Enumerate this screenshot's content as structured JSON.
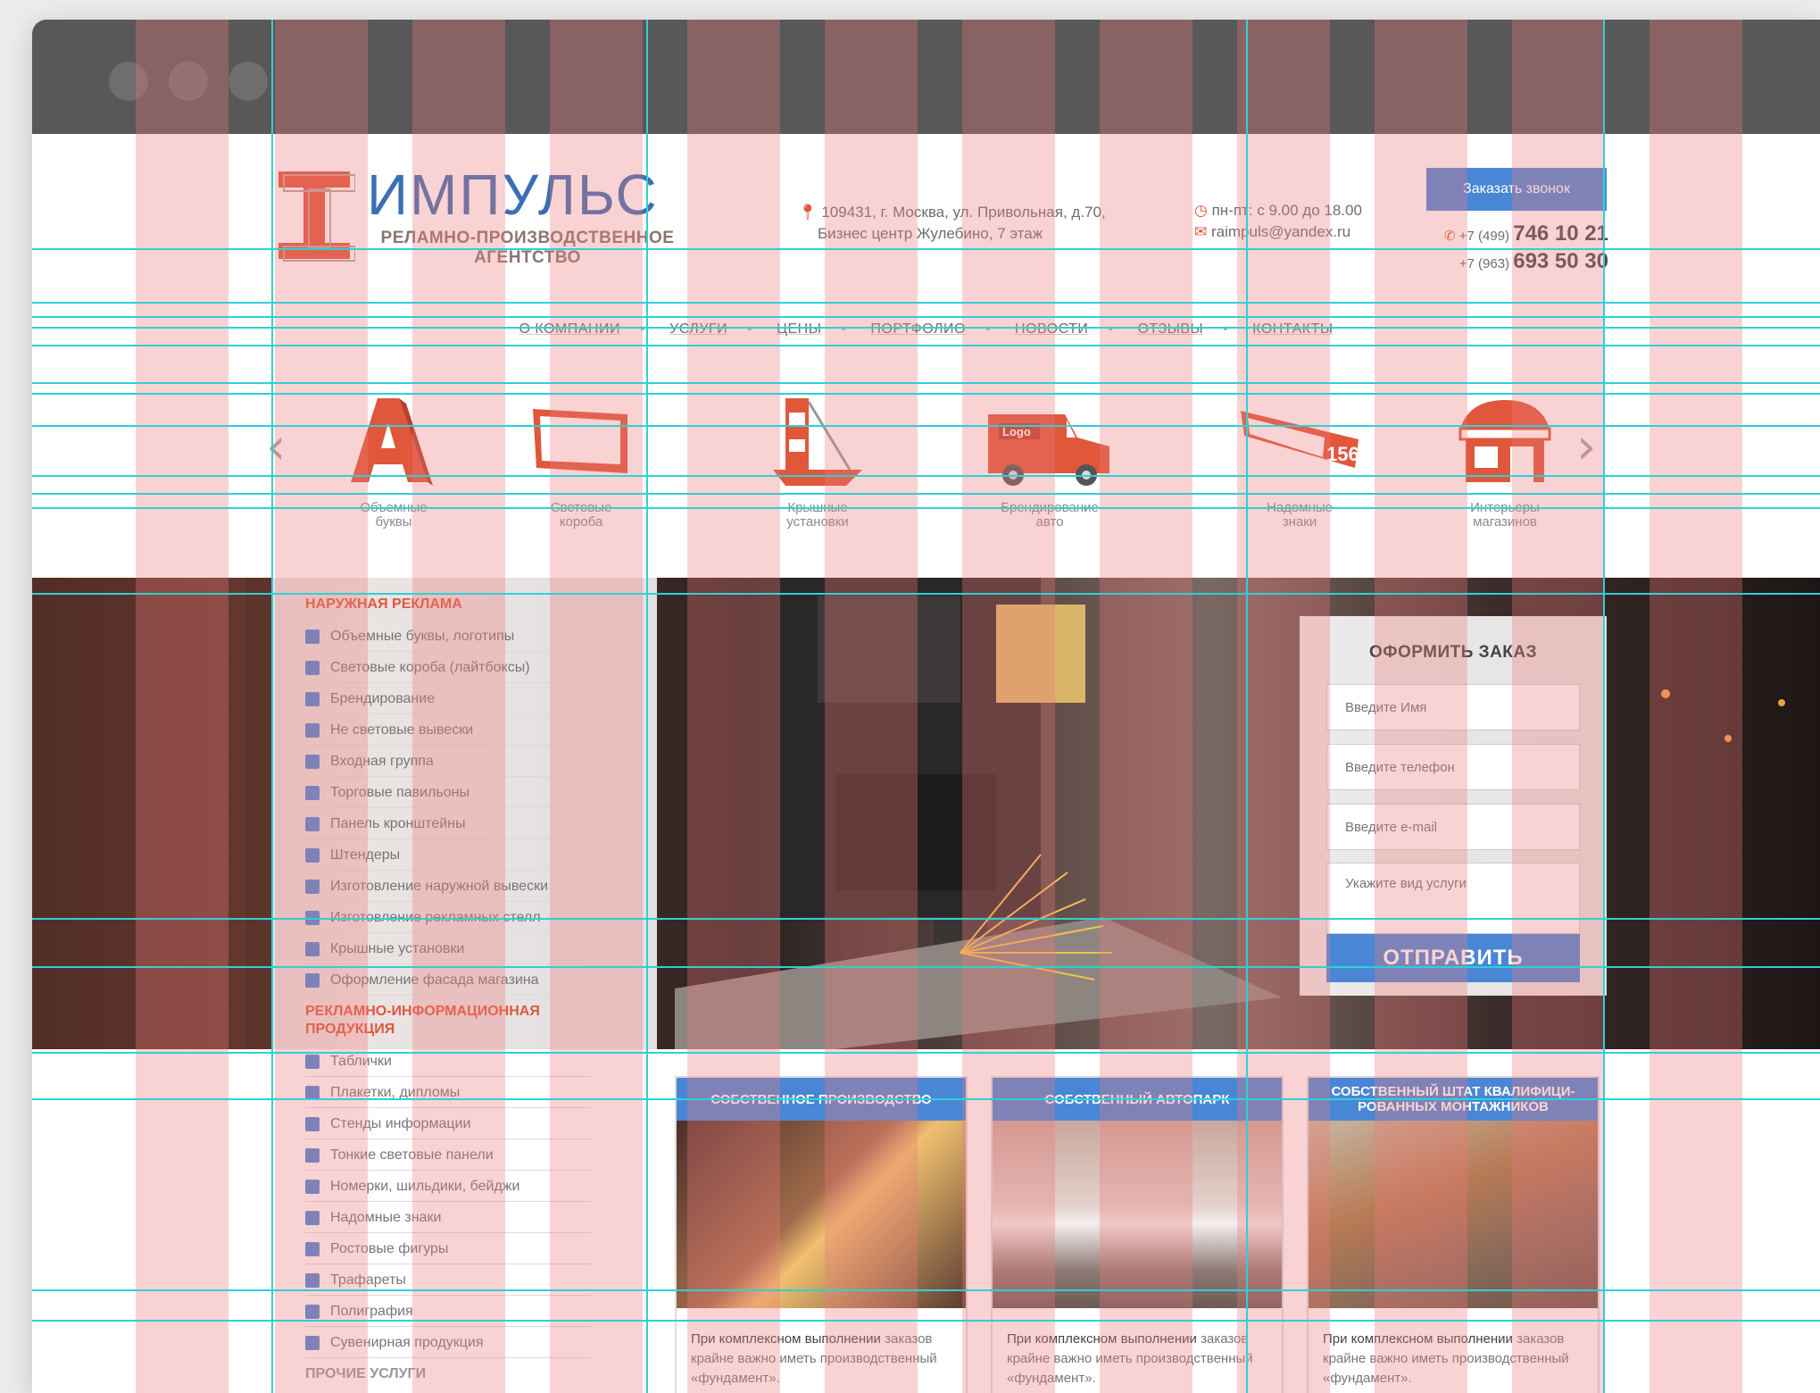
{
  "header": {
    "logo_title": "ИМПУЛЬС",
    "logo_sub1": "РЕЛАМНО-ПРОИЗВОДСТВЕННОЕ",
    "logo_sub2": "АГЕНТСТВО",
    "address_line1": "109431, г. Москва, ул. Привольная, д.70,",
    "address_line2": "Бизнес центр Жулебино, 7 этаж",
    "hours": "пн-пт: с 9.00 до 18.00",
    "email": "raimpuls@yandex.ru",
    "callback_button": "Заказать звонок",
    "phone1_prefix": "+7 (499)",
    "phone1_number": "746 10 21",
    "phone2_prefix": "+7 (963)",
    "phone2_number": "693 50 30"
  },
  "nav": {
    "items": [
      "О КОМПАНИИ",
      "УСЛУГИ",
      "ЦЕНЫ",
      "ПОРТФОЛИО",
      "НОВОСТИ",
      "ОТЗЫВЫ",
      "КОНТАКТЫ"
    ]
  },
  "carousel": {
    "items": [
      {
        "line1": "Объемные",
        "line2": "буквы"
      },
      {
        "line1": "Световые",
        "line2": "короба"
      },
      {
        "line1": "Крышные",
        "line2": "установки"
      },
      {
        "line1": "Брендирование",
        "line2": "авто"
      },
      {
        "line1": "Надомные",
        "line2": "знаки"
      },
      {
        "line1": "Интерьеры",
        "line2": "магазинов"
      }
    ],
    "truck_logo": "Logo",
    "sign_number": "156"
  },
  "sidebar": {
    "head1": "НАРУЖНАЯ РЕКЛАМА",
    "group1": [
      "Объемные буквы, логотипы",
      "Световые короба (лайтбоксы)",
      "Брендирование",
      "Не световые вывески",
      "Входная группа",
      "Торговые павильоны",
      "Панель кронштейны",
      "Штендеры",
      "Изготовление наружной вывески",
      "Изготовление рекламных стелл",
      "Крышные установки",
      "Оформление фасада магазина"
    ],
    "head2": "РЕКЛАМНО-ИНФОРМАЦИОННАЯ ПРОДУКЦИЯ",
    "group2": [
      "Таблички",
      "Плакетки, дипломы",
      "Стенды информации",
      "Тонкие световые панели",
      "Номерки, шильдики, бейджи",
      "Надомные знаки",
      "Ростовые фигуры",
      "Трафареты",
      "Полиграфия",
      "Сувенирная продукция"
    ],
    "head3": "ПРОЧИЕ УСЛУГИ"
  },
  "order_form": {
    "title": "ОФОРМИТЬ ЗАКАЗ",
    "name_placeholder": "Введите Имя",
    "phone_placeholder": "Введите телефон",
    "email_placeholder": "Введите e-mail",
    "service_placeholder": "Укажите вид услуги",
    "submit": "ОТПРАВИТЬ"
  },
  "cards": [
    {
      "title": "СОБСТВЕННОЕ ПРОИЗВОДСТВО",
      "text_bold": "При комплексном выполнении",
      "text": "заказов крайне важно иметь производственный «фундамент»."
    },
    {
      "title": "СОБСТВЕННЫЙ АВТОПАРК",
      "text_bold": "При комплексном выполнении",
      "text": "заказов крайне важно иметь производственный «фундамент»."
    },
    {
      "title": "СОБСТВЕННЫЙ ШТАТ КВАЛИФИЦИ-РОВАННЫХ МОНТАЖНИКОВ",
      "text_bold": "При комплексном выполнении",
      "text": "заказов крайне важно иметь производственный «фундамент»."
    }
  ],
  "colors": {
    "accent_blue": "#4a86d6",
    "accent_orange": "#e0573c",
    "titlebar": "#585858"
  }
}
